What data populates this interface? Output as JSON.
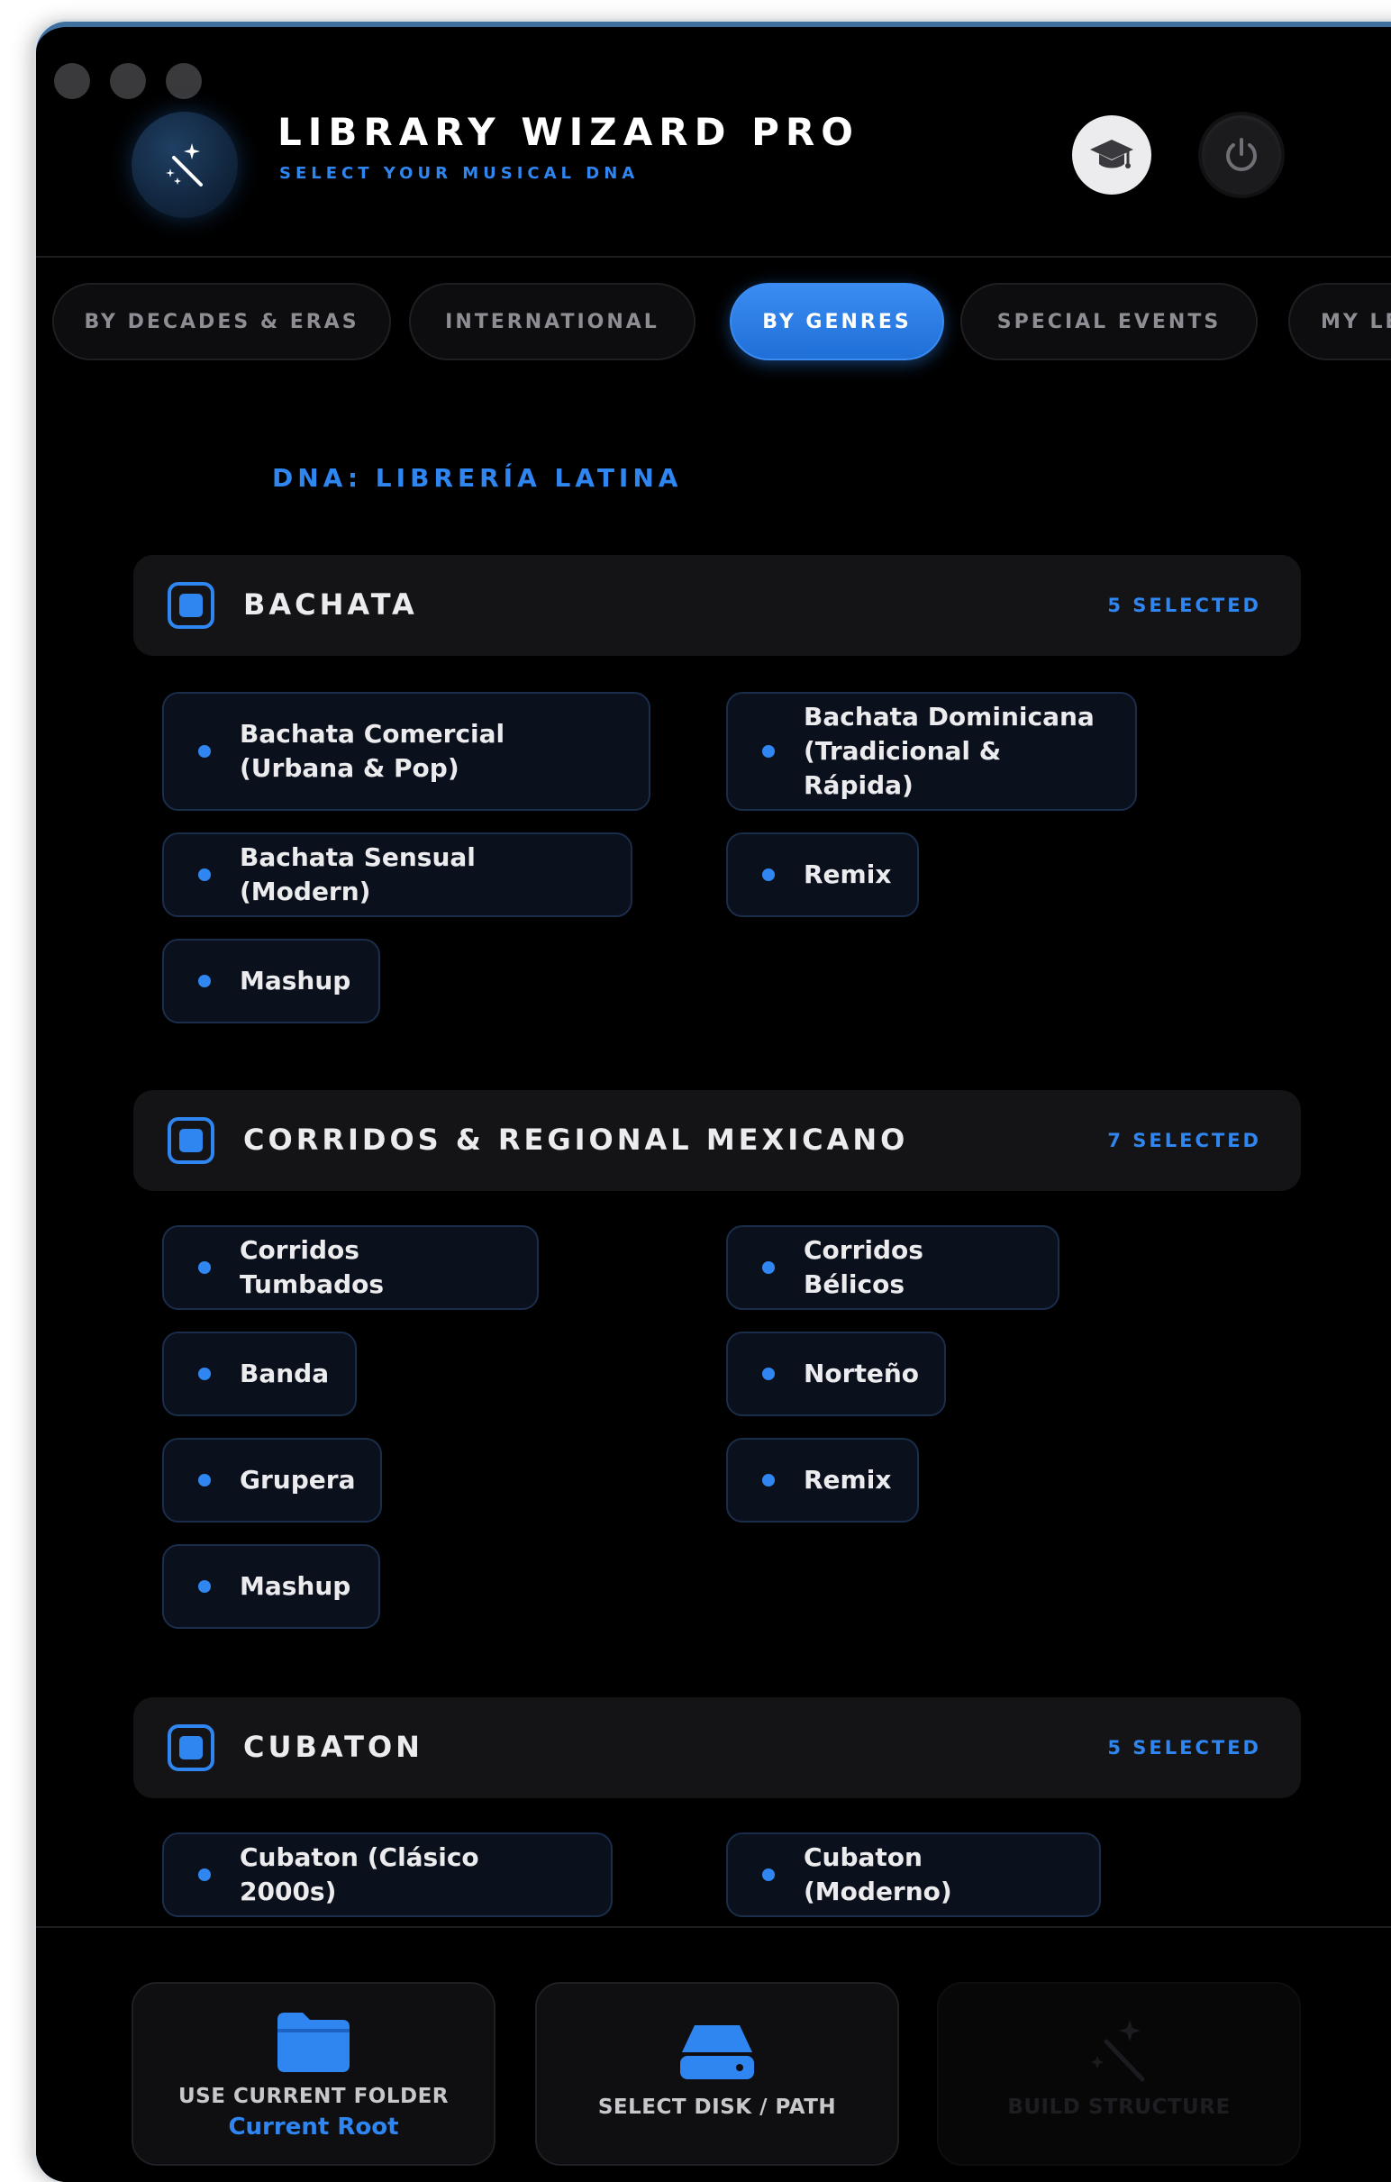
{
  "header": {
    "title": "LIBRARY WIZARD PRO",
    "subtitle": "SELECT YOUR MUSICAL DNA"
  },
  "tabs": [
    {
      "label": "BY DECADES & ERAS",
      "active": false
    },
    {
      "label": "INTERNATIONAL",
      "active": false
    },
    {
      "label": "BY GENRES",
      "active": true
    },
    {
      "label": "SPECIAL EVENTS",
      "active": false
    },
    {
      "label": "MY LEGA",
      "active": false
    }
  ],
  "dna_label": "DNA: LIBRERÍA LATINA",
  "sections": [
    {
      "title": "BACHATA",
      "count": "5 SELECTED",
      "items": [
        "Bachata Comercial (Urbana & Pop)",
        "Bachata Dominicana (Tradicional & Rápida)",
        "Bachata Sensual (Modern)",
        "Remix",
        "Mashup"
      ]
    },
    {
      "title": "CORRIDOS & REGIONAL MEXICANO",
      "count": "7 SELECTED",
      "items": [
        "Corridos Tumbados",
        "Corridos Bélicos",
        "Banda",
        "Norteño",
        "Grupera",
        "Remix",
        "Mashup"
      ]
    },
    {
      "title": "CUBATON",
      "count": "5 SELECTED",
      "items": [
        "Cubaton (Clásico 2000s)",
        "Cubaton (Moderno)"
      ]
    }
  ],
  "footer": {
    "use_current_folder": "USE CURRENT FOLDER",
    "current_root": "Current Root",
    "select_disk": "SELECT DISK / PATH",
    "build_structure": "BUILD STRUCTURE"
  },
  "colors": {
    "accent": "#2f86f0",
    "background": "#000000",
    "panel": "#141416"
  },
  "icons": [
    "magic-wand-icon",
    "graduation-cap-icon",
    "power-icon",
    "folder-icon",
    "hard-drive-icon"
  ]
}
